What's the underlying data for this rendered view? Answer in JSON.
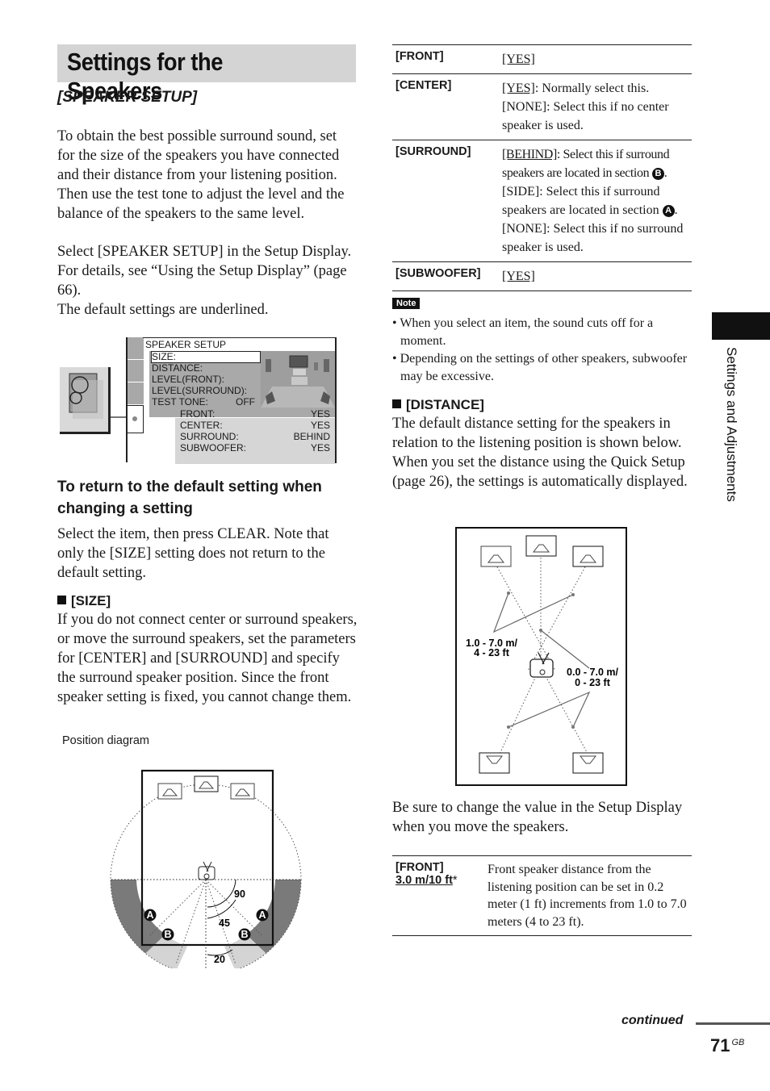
{
  "page": {
    "title": "Settings for the Speakers",
    "subtitle": "[SPEAKER SETUP]",
    "intro": "To obtain the best possible surround sound, set for the size of the speakers you have connected and their distance from your listening position. Then use the test tone to adjust the level and the balance of the speakers to the same level.",
    "select_text_1": "Select [SPEAKER SETUP] in the Setup Display. For details, see “Using the Setup Display” (page 66).",
    "select_text_2": "The default settings are underlined.",
    "side_tab_label": "Settings and Adjustments",
    "continued": "continued",
    "page_number": "71",
    "page_suffix": "GB"
  },
  "setup_screen": {
    "header": "SPEAKER SETUP",
    "menu": [
      "SIZE:",
      "DISTANCE:",
      "LEVEL(FRONT):",
      "LEVEL(SURROUND):",
      "TEST TONE:"
    ],
    "test_tone_value": "OFF",
    "sub_items": [
      {
        "label": "FRONT:",
        "value": "YES"
      },
      {
        "label": "CENTER:",
        "value": "YES"
      },
      {
        "label": "SURROUND:",
        "value": "BEHIND"
      },
      {
        "label": "SUBWOOFER:",
        "value": "YES"
      }
    ]
  },
  "default_section": {
    "heading": "To return to the default setting when changing a setting",
    "body": "Select the item, then press CLEAR. Note that only the [SIZE] setting does not return to the default setting."
  },
  "size_section": {
    "heading": "[SIZE]",
    "body": "If you do not connect center or surround speakers, or move the surround speakers, set the parameters for [CENTER] and [SURROUND] and specify the surround speaker position. Since the front speaker setting is fixed, you cannot change them.",
    "diagram_caption": "Position diagram",
    "angles": [
      "90",
      "45",
      "20"
    ],
    "section_labels": [
      "A",
      "B"
    ]
  },
  "size_table": [
    {
      "key": "[FRONT]",
      "lines": [
        {
          "u": "[YES]",
          "t": ""
        }
      ]
    },
    {
      "key": "[CENTER]",
      "lines": [
        {
          "u": "[YES]",
          "t": ": Normally select this."
        },
        {
          "u": "",
          "t": "[NONE]: Select this if no center speaker is used."
        }
      ]
    },
    {
      "key": "[SURROUND]",
      "lines": [
        {
          "u": "[BEHIND]",
          "t": ": Select this if surround speakers are located in section",
          "badge": "B"
        },
        {
          "u": "",
          "t": "[SIDE]: Select this if surround speakers are located in section",
          "badge": "A"
        },
        {
          "u": "",
          "t": "[NONE]: Select this if no surround speaker is used."
        }
      ]
    },
    {
      "key": "[SUBWOOFER]",
      "lines": [
        {
          "u": "[YES]",
          "t": ""
        }
      ]
    }
  ],
  "note": {
    "label": "Note",
    "items": [
      "When you select an item, the sound cuts off for a moment.",
      "Depending on the settings of other speakers, subwoofer may be excessive."
    ]
  },
  "distance_section": {
    "heading": "[DISTANCE]",
    "body": "The default distance setting for the speakers in relation to the listening position is shown below. When you set the distance using the Quick Setup (page 26), the settings is automatically displayed.",
    "diagram_left_label_1": "1.0 - 7.0 m/",
    "diagram_left_label_2": "4 - 23 ft",
    "diagram_right_label_1": "0.0 - 7.0 m/",
    "diagram_right_label_2": "0 - 23 ft",
    "after_text": "Be sure to change the value in the Setup Display when you move the speakers."
  },
  "distance_table": [
    {
      "key": "[FRONT]",
      "default": "3.0 m/10 ft",
      "asterisk": "*",
      "desc": "Front speaker distance from the listening position can be set in 0.2 meter (1 ft) increments from 1.0 to 7.0 meters (4 to 23 ft)."
    }
  ]
}
